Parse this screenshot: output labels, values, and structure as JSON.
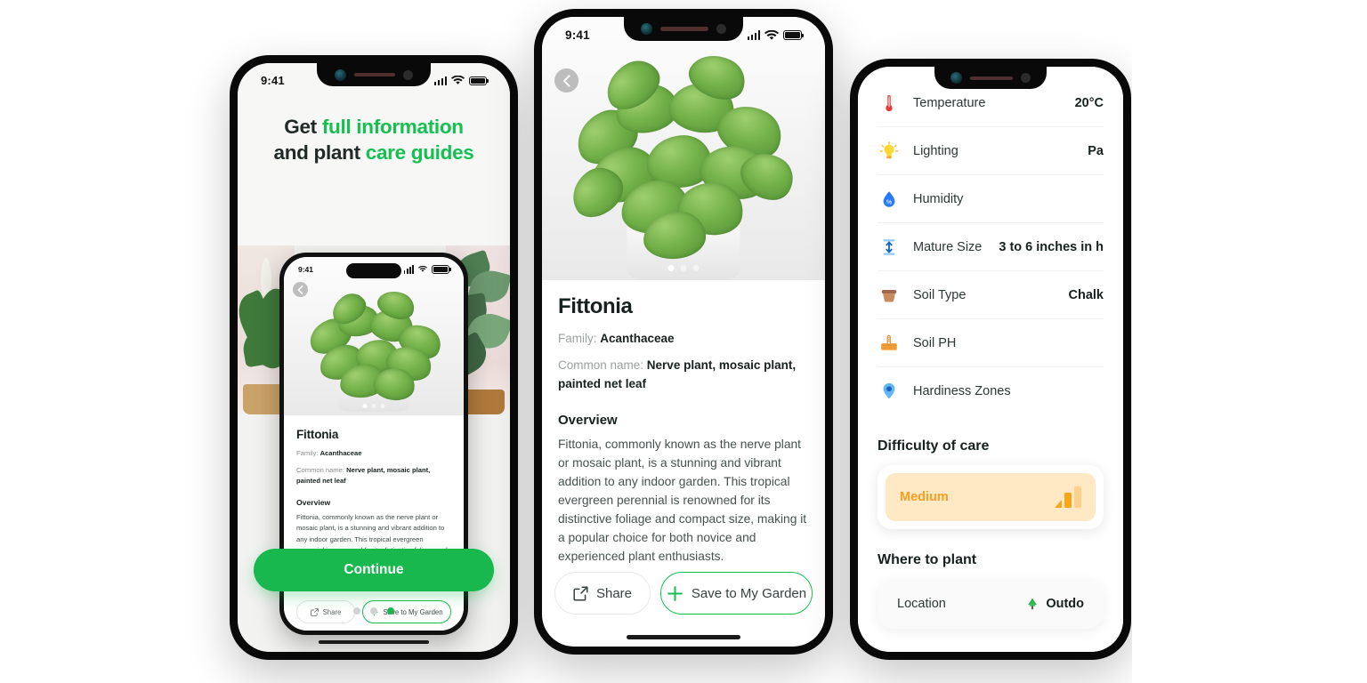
{
  "onboarding": {
    "status_time": "9:41",
    "headline_line1_plain": "Get ",
    "headline_line1_highlight": "full information",
    "headline_line2_plain": "and plant ",
    "headline_line2_highlight": "care guides",
    "cta_label": "Continue",
    "pager": [
      "1",
      "2",
      "3"
    ],
    "active_page_index": 2,
    "accent_color": "#18b84f"
  },
  "inner_preview": {
    "status_time": "9:41",
    "title": "Fittonia",
    "family_label": "Family: ",
    "family_value": "Acanthaceae",
    "common_label": "Common name: ",
    "common_value": "Nerve plant, mosaic plant, painted net leaf",
    "overview_heading": "Overview",
    "overview_text": "Fittonia, commonly known as the nerve plant or mosaic plant, is a stunning and vibrant addition to any indoor garden. This tropical evergreen perennial is renowned for its distinctive foliage and compact size, making it a popular choice for both novice and experienced plant enthusiasts.",
    "share_label": "Share",
    "save_label": "Save to My Garden"
  },
  "detail": {
    "status_time": "9:41",
    "title": "Fittonia",
    "family_label": "Family: ",
    "family_value": "Acanthaceae",
    "common_label": "Common name: ",
    "common_value": "Nerve plant, mosaic plant, painted net leaf",
    "overview_heading": "Overview",
    "overview_text": "Fittonia, commonly known as the nerve plant or mosaic plant, is a stunning and vibrant addition to any indoor garden. This tropical evergreen perennial is renowned for its distinctive foliage and compact size, making it a popular choice for both novice and experienced plant enthusiasts.",
    "share_label": "Share",
    "save_label": "Save to My Garden",
    "carousel_dots": 3,
    "carousel_active": 0,
    "accent_color": "#16bf51"
  },
  "care": {
    "rows": [
      {
        "icon": "thermometer-icon",
        "label": "Temperature",
        "value": "20°C"
      },
      {
        "icon": "lightbulb-icon",
        "label": "Lighting",
        "value": "Pa"
      },
      {
        "icon": "water-drop-icon",
        "label": "Humidity",
        "value": ""
      },
      {
        "icon": "height-arrows-icon",
        "label": "Mature Size",
        "value": "3 to 6 inches in h"
      },
      {
        "icon": "soil-pot-icon",
        "label": "Soil Type",
        "value": "Chalk"
      },
      {
        "icon": "soil-ph-icon",
        "label": "Soil PH",
        "value": ""
      },
      {
        "icon": "map-pin-icon",
        "label": "Hardiness Zones",
        "value": ""
      }
    ],
    "difficulty_heading": "Difficulty of care",
    "difficulty_value": "Medium",
    "difficulty_color": "#f5a01f",
    "difficulty_bg": "#ffe8c4",
    "where_heading": "Where to plant",
    "location_label": "Location",
    "location_value": "Outdo",
    "location_icon": "tree-icon"
  }
}
